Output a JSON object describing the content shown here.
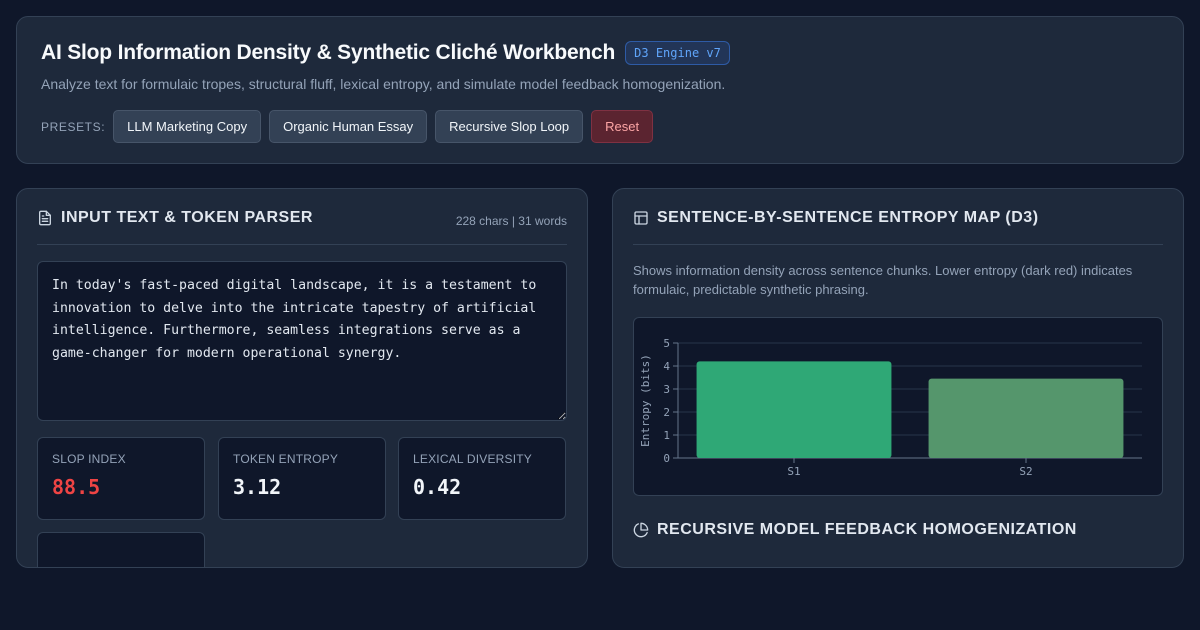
{
  "header": {
    "title": "AI Slop Information Density & Synthetic Cliché Workbench",
    "badge": "D3 Engine v7",
    "subtitle": "Analyze text for formulaic tropes, structural fluff, lexical entropy, and simulate model feedback homogenization.",
    "presets_label": "PRESETS:",
    "presets": [
      "LLM Marketing Copy",
      "Organic Human Essay",
      "Recursive Slop Loop"
    ],
    "reset_label": "Reset"
  },
  "input_panel": {
    "title": "INPUT TEXT & TOKEN PARSER",
    "counts": "228 chars | 31 words",
    "text": "In today's fast-paced digital landscape, it is a testament to innovation to delve into the intricate tapestry of artificial intelligence. Furthermore, seamless integrations serve as a game-changer for modern operational synergy.",
    "metrics": [
      {
        "label": "SLOP INDEX",
        "value": "88.5"
      },
      {
        "label": "TOKEN ENTROPY",
        "value": "3.12"
      },
      {
        "label": "LEXICAL DIVERSITY",
        "value": "0.42"
      }
    ]
  },
  "entropy_panel": {
    "title": "SENTENCE-BY-SENTENCE ENTROPY MAP (D3)",
    "description": "Shows information density across sentence chunks. Lower entropy (dark red) indicates formulaic, predictable synthetic phrasing.",
    "section2_title": "RECURSIVE MODEL FEEDBACK HOMOGENIZATION"
  },
  "colors": {
    "danger": "#ef4444",
    "bar_high": "#2fa876",
    "bar_mid": "#55966c",
    "accent": "#60a5fa"
  },
  "icons": {
    "input_panel": "file-text-icon",
    "entropy_panel": "layout-icon",
    "feedback_section": "pie-chart-icon"
  },
  "chart_data": {
    "type": "bar",
    "categories": [
      "S1",
      "S2"
    ],
    "values": [
      4.2,
      3.45
    ],
    "ylabel": "Entropy (bits)",
    "xlabel": "",
    "ylim": [
      0,
      5
    ],
    "yticks": [
      0,
      1,
      2,
      3,
      4,
      5
    ],
    "grid": true
  }
}
